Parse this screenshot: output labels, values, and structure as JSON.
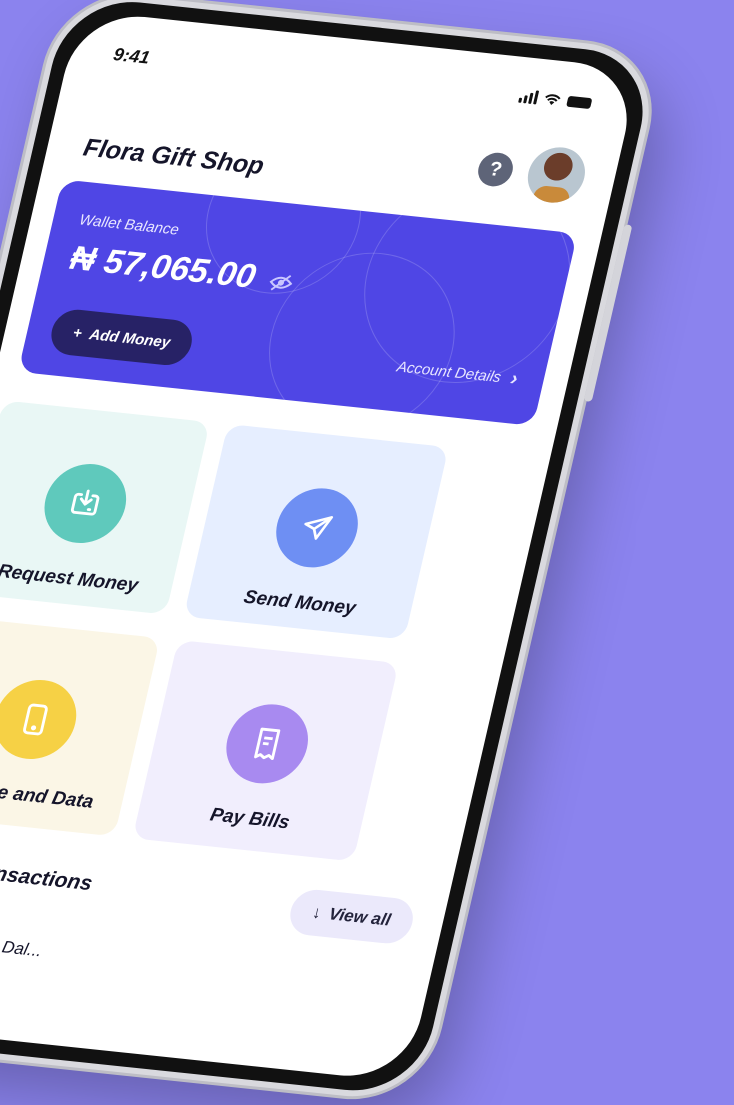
{
  "status_bar": {
    "time": "9:41"
  },
  "header": {
    "shop_name": "Flora Gift Shop",
    "help_symbol": "?"
  },
  "wallet": {
    "label": "Wallet Balance",
    "balance": "₦ 57,065.00",
    "add_money_label": "Add Money",
    "add_money_symbol": "+",
    "account_details_label": "Account Details",
    "account_details_chevron": "›",
    "card_color": "#4f46e5"
  },
  "actions": [
    {
      "label": "Request Money",
      "icon": "download-tray-icon",
      "tile_color": "#e9f7f5",
      "circle_color": "#5fc9bc"
    },
    {
      "label": "Send Money",
      "icon": "paper-plane-icon",
      "tile_color": "#e6eeff",
      "circle_color": "#6e8ff3"
    },
    {
      "label": "Airtime and Data",
      "icon": "smartphone-icon",
      "tile_color": "#fbf6e6",
      "circle_color": "#f6d145"
    },
    {
      "label": "Pay Bills",
      "icon": "receipt-icon",
      "tile_color": "#f1eefd",
      "circle_color": "#a88af0"
    }
  ],
  "recent": {
    "title": "Recent transactions",
    "view_all_label": "View all",
    "view_all_symbol": "↓",
    "first_item_name": "Jackson Dal..."
  }
}
